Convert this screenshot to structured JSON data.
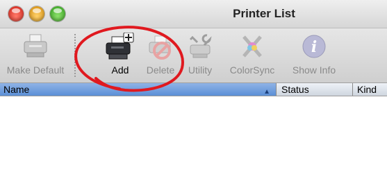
{
  "window": {
    "title": "Printer List"
  },
  "toolbar": {
    "items": [
      {
        "label": "Make Default",
        "icon": "printer-icon",
        "enabled": false
      },
      {
        "label": "Add",
        "icon": "add-printer-icon",
        "enabled": true
      },
      {
        "label": "Delete",
        "icon": "delete-printer-icon",
        "enabled": false
      },
      {
        "label": "Utility",
        "icon": "utility-icon",
        "enabled": false
      },
      {
        "label": "ColorSync",
        "icon": "colorsync-icon",
        "enabled": false
      },
      {
        "label": "Show Info",
        "icon": "info-icon",
        "enabled": false
      }
    ]
  },
  "table": {
    "columns": [
      "Name",
      "Status",
      "Kind"
    ],
    "sort_column": "Name",
    "rows": []
  },
  "annotation": {
    "color": "#e0191f",
    "target": "Add"
  }
}
